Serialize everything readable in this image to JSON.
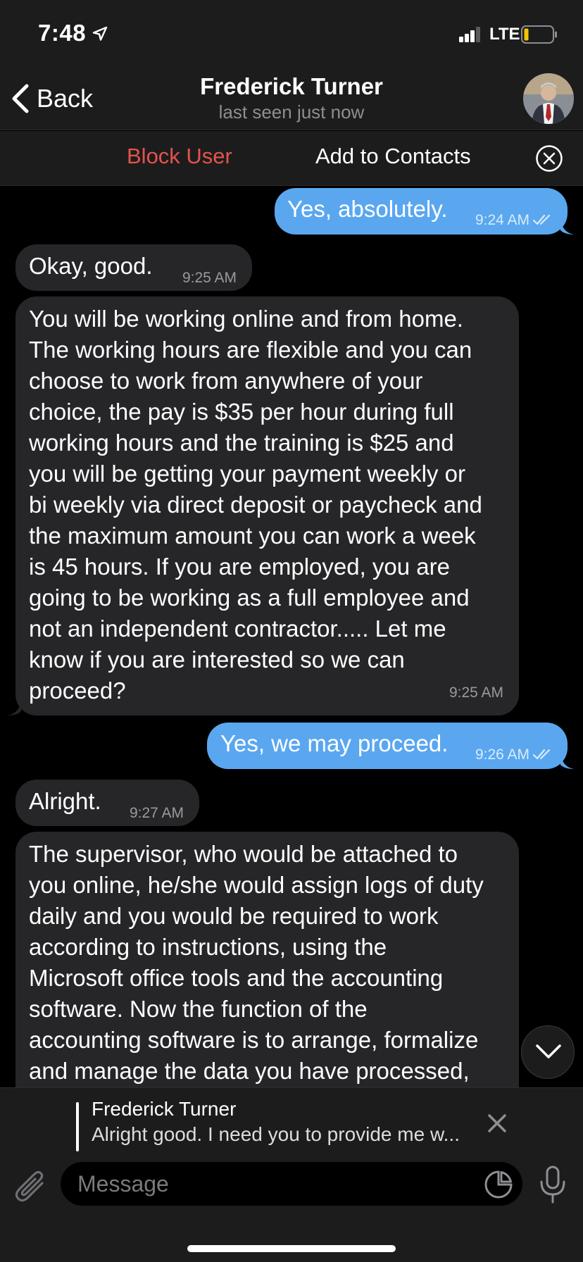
{
  "status_bar": {
    "time": "7:48",
    "network": "LTE",
    "colors": {
      "battery_low": "#f5c400"
    }
  },
  "header": {
    "back_label": "Back",
    "contact_name": "Frederick Turner",
    "last_seen": "last seen just now"
  },
  "action_bar": {
    "block_label": "Block User",
    "add_contact_label": "Add to Contacts"
  },
  "messages": [
    {
      "direction": "outgoing",
      "text": "Yes, absolutely.",
      "time": "9:24 AM",
      "status": "read"
    },
    {
      "direction": "incoming",
      "text": "Okay, good.",
      "time": "9:25 AM"
    },
    {
      "direction": "incoming",
      "text": "You will be working online and from home.\nThe working hours are flexible and you can\nchoose to work from anywhere of your\nchoice, the pay is $35 per hour during full\nworking hours and the training is $25 and\nyou will be getting your payment weekly or\nbi weekly via direct deposit or paycheck and\nthe maximum amount you can work a week\nis 45 hours. If you are employed, you are\ngoing to be working as a full employee and\nnot an independent contractor..... Let me\nknow if you are interested so we can\nproceed?",
      "time": "9:25 AM"
    },
    {
      "direction": "outgoing",
      "text": "Yes, we may proceed.",
      "time": "9:26 AM",
      "status": "read"
    },
    {
      "direction": "incoming",
      "text": "Alright.",
      "time": "9:27 AM"
    },
    {
      "direction": "incoming",
      "text": "The supervisor, who would be attached to\nyou online, he/she would assign logs of duty\ndaily and you would be required to work\naccording to instructions, using the\nMicrosoft office tools and the accounting\nsoftware. Now the function of the\naccounting software is to arrange, formalize\nand manage the data you have processed,",
      "time": ""
    }
  ],
  "reply_preview": {
    "name": "Frederick Turner",
    "text": "Alright good. I need you to provide me w..."
  },
  "composer": {
    "placeholder": "Message"
  },
  "colors": {
    "outgoing_bubble": "#5aa7f0",
    "incoming_bubble": "#262628",
    "block_red": "#e5534b"
  }
}
